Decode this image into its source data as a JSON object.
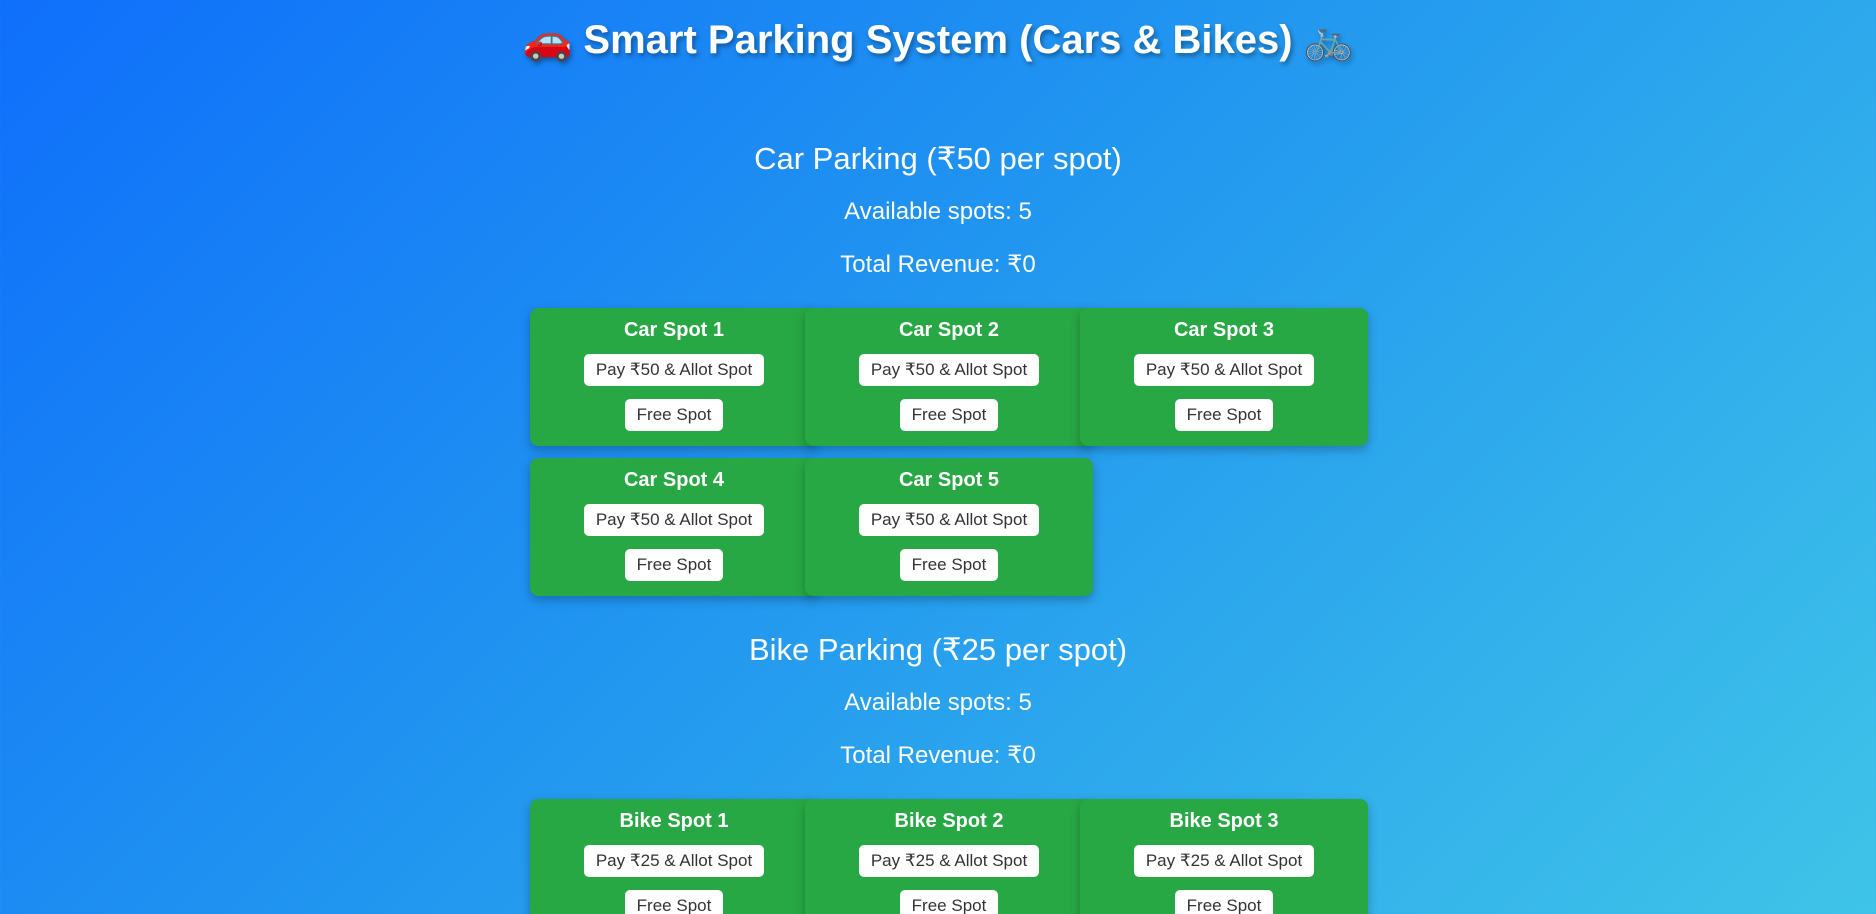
{
  "header": {
    "title": "Smart Parking System (Cars & Bikes)",
    "left_emoji": "🚗",
    "right_emoji": "🚲"
  },
  "car_section": {
    "title": "Car Parking (₹50 per spot)",
    "available": "Available spots: 5",
    "revenue": "Total Revenue: ₹0",
    "spots": [
      {
        "name": "Car Spot 1",
        "pay_label": "Pay ₹50 & Allot Spot",
        "free_label": "Free Spot"
      },
      {
        "name": "Car Spot 2",
        "pay_label": "Pay ₹50 & Allot Spot",
        "free_label": "Free Spot"
      },
      {
        "name": "Car Spot 3",
        "pay_label": "Pay ₹50 & Allot Spot",
        "free_label": "Free Spot"
      },
      {
        "name": "Car Spot 4",
        "pay_label": "Pay ₹50 & Allot Spot",
        "free_label": "Free Spot"
      },
      {
        "name": "Car Spot 5",
        "pay_label": "Pay ₹50 & Allot Spot",
        "free_label": "Free Spot"
      }
    ]
  },
  "bike_section": {
    "title": "Bike Parking (₹25 per spot)",
    "available": "Available spots: 5",
    "revenue": "Total Revenue: ₹0",
    "spots": [
      {
        "name": "Bike Spot 1",
        "pay_label": "Pay ₹25 & Allot Spot",
        "free_label": "Free Spot"
      },
      {
        "name": "Bike Spot 2",
        "pay_label": "Pay ₹25 & Allot Spot",
        "free_label": "Free Spot"
      },
      {
        "name": "Bike Spot 3",
        "pay_label": "Pay ₹25 & Allot Spot",
        "free_label": "Free Spot"
      }
    ]
  },
  "colors": {
    "spot_background": "#28a745",
    "button_background": "#ffffff",
    "gradient_start": "#0f6ffb",
    "gradient_end": "#3fc4e8"
  }
}
